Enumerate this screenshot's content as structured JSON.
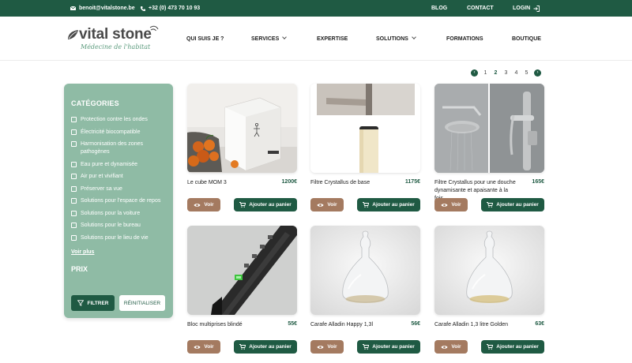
{
  "topbar": {
    "email": "benoit@vitalstone.be",
    "phone": "+32 (0) 473 70 10 93",
    "blog": "BLOG",
    "contact": "CONTACT",
    "login": "LOGIN"
  },
  "logo": {
    "brand": "vital stone",
    "tagline": "Médecine de l'habitat"
  },
  "nav": [
    {
      "label": "QUI SUIS JE ?"
    },
    {
      "label": "SERVICES"
    },
    {
      "label": "EXPERTISE"
    },
    {
      "label": "SOLUTIONS"
    },
    {
      "label": "FORMATIONS"
    },
    {
      "label": "BOUTIQUE"
    }
  ],
  "pager": {
    "pages": [
      "1",
      "2",
      "3",
      "4",
      "5"
    ],
    "current": "2"
  },
  "sidebar": {
    "title": "CATÉGORIES",
    "categories": [
      "Protection contre les ondes",
      "Électricité biocompatible",
      "Harmonisation des zones pathogènes",
      "Eau pure et dynamisée",
      "Air pur et vivifiant",
      "Préserver sa vue",
      "Solutions pour l'espace de repos",
      "Solutions pour la voiture",
      "Solutions pour le bureau",
      "Solutions pour le lieu de vie"
    ],
    "more": "Voir plus",
    "price_title": "PRIX",
    "filter_button": "FILTRER",
    "reset_button": "RÉINITIALISER"
  },
  "products": [
    {
      "name": "Le cube MOM 3",
      "price": "1200€"
    },
    {
      "name": "Filtre Crystallus de base",
      "price": "1175€"
    },
    {
      "name": "Filtre Crystallus pour une douche dynamisante et apaisante à la fois",
      "price": "165€"
    },
    {
      "name": "Bloc multiprises blindé",
      "price": "55€"
    },
    {
      "name": "Carafe Alladin Happy 1,3l",
      "price": "56€"
    },
    {
      "name": "Carafe Alladin 1,3 litre Golden",
      "price": "63€"
    }
  ],
  "buttons": {
    "view": "Voir",
    "add_to_cart": "Ajouter au panier"
  },
  "colors": {
    "primary": "#1f5a43",
    "sidebar": "#8fbba5",
    "view_button": "#a47a60"
  }
}
